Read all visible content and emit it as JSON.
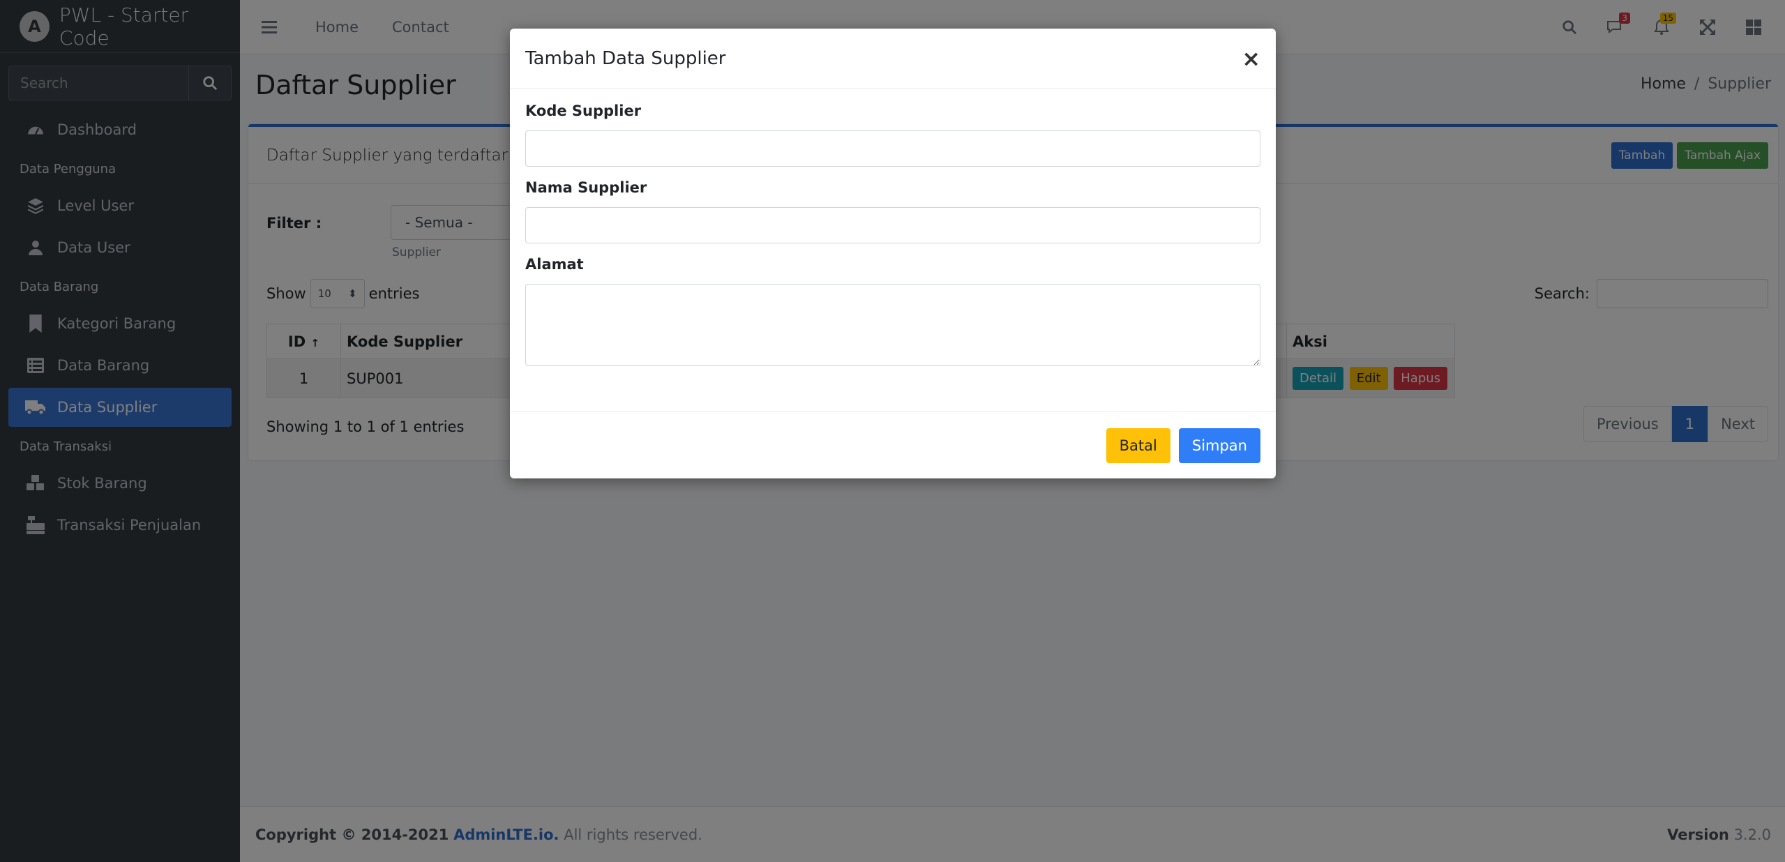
{
  "brand": {
    "logo_letter": "A",
    "title": "PWL - Starter Code"
  },
  "sidebar": {
    "search_placeholder": "Search",
    "items": [
      {
        "label": "Dashboard",
        "icon": "dashboard-icon"
      },
      {
        "header": "Data Pengguna"
      },
      {
        "label": "Level User",
        "icon": "layers-icon"
      },
      {
        "label": "Data User",
        "icon": "user-icon"
      },
      {
        "header": "Data Barang"
      },
      {
        "label": "Kategori Barang",
        "icon": "bookmark-icon"
      },
      {
        "label": "Data Barang",
        "icon": "list-icon"
      },
      {
        "label": "Data Supplier",
        "icon": "truck-icon",
        "active": true
      },
      {
        "header": "Data Transaksi"
      },
      {
        "label": "Stok Barang",
        "icon": "cubes-icon"
      },
      {
        "label": "Transaksi Penjualan",
        "icon": "cash-register-icon"
      }
    ]
  },
  "topbar": {
    "links": [
      "Home",
      "Contact"
    ],
    "messages_badge": "3",
    "notifications_badge": "15"
  },
  "page": {
    "title": "Daftar Supplier",
    "breadcrumb": [
      "Home",
      "Supplier"
    ]
  },
  "card": {
    "title": "Daftar Supplier yang terdaftar dala",
    "add_label": "Tambah",
    "add_ajax_label": "Tambah Ajax",
    "filter_label": "Filter :",
    "filter_value": "- Semua -",
    "filter_help": "Supplier",
    "show_label": "Show",
    "entries_value": "10",
    "entries_label": "entries",
    "search_label": "Search:",
    "columns": [
      "ID",
      "Kode Supplier",
      "Aksi"
    ],
    "rows": [
      {
        "id": "1",
        "kode": "SUP001"
      }
    ],
    "actions": {
      "detail": "Detail",
      "edit": "Edit",
      "hapus": "Hapus"
    },
    "info": "Showing 1 to 1 of 1 entries",
    "pager": {
      "prev": "Previous",
      "page": "1",
      "next": "Next"
    }
  },
  "footer": {
    "copyright": "Copyright © 2014-2021",
    "link": "AdminLTE.io.",
    "rights": " All rights reserved.",
    "version_label": "Version",
    "version": "3.2.0"
  },
  "modal": {
    "title": "Tambah Data Supplier",
    "close": "×",
    "fields": {
      "kode_label": "Kode Supplier",
      "nama_label": "Nama Supplier",
      "alamat_label": "Alamat"
    },
    "batal_label": "Batal",
    "simpan_label": "Simpan"
  }
}
